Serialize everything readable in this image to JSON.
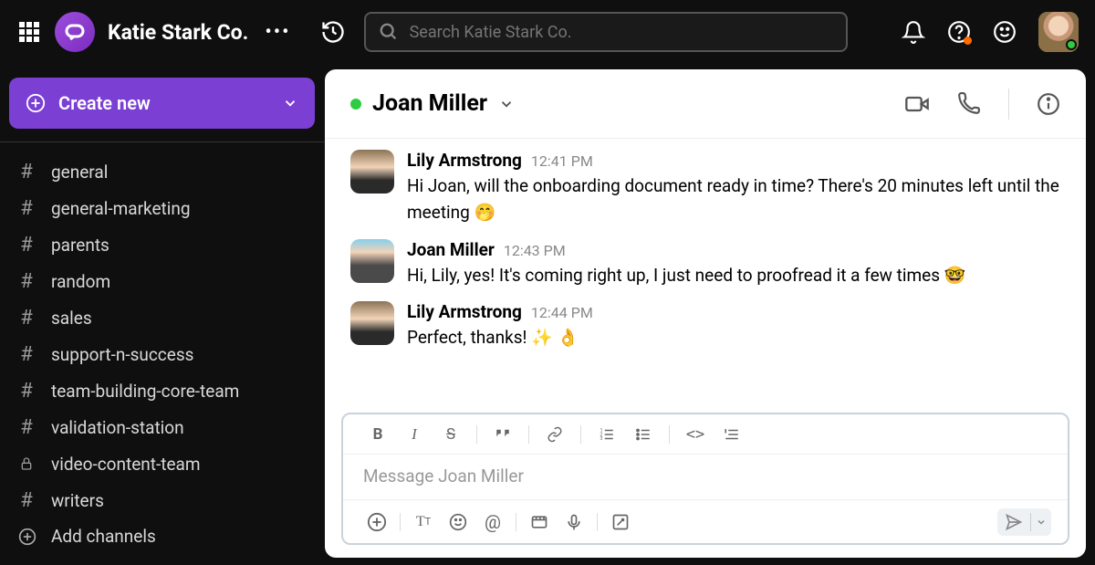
{
  "workspace_name": "Katie Stark Co.",
  "search": {
    "placeholder": "Search Katie Stark Co."
  },
  "create_button": "Create new",
  "channels": [
    {
      "name": "general",
      "type": "hash"
    },
    {
      "name": "general-marketing",
      "type": "hash"
    },
    {
      "name": "parents",
      "type": "hash"
    },
    {
      "name": "random",
      "type": "hash"
    },
    {
      "name": "sales",
      "type": "hash"
    },
    {
      "name": "support-n-success",
      "type": "hash"
    },
    {
      "name": "team-building-core-team",
      "type": "hash"
    },
    {
      "name": "validation-station",
      "type": "hash"
    },
    {
      "name": "video-content-team",
      "type": "lock"
    },
    {
      "name": "writers",
      "type": "hash"
    }
  ],
  "add_channels_label": "Add channels",
  "conversation": {
    "title": "Joan Miller",
    "messages": [
      {
        "author": "Lily Armstrong",
        "time": "12:41 PM",
        "text": "Hi Joan, will the onboarding document ready in time? There's 20 minutes left until the meeting 🤭",
        "avatar": "lily"
      },
      {
        "author": "Joan Miller",
        "time": "12:43 PM",
        "text": "Hi, Lily, yes! It's coming right up, I just need to proofread it a few times 🤓",
        "avatar": "joan"
      },
      {
        "author": "Lily Armstrong",
        "time": "12:44 PM",
        "text": "Perfect, thanks! ✨ 👌",
        "avatar": "lily"
      }
    ],
    "composer_placeholder": "Message Joan Miller"
  }
}
